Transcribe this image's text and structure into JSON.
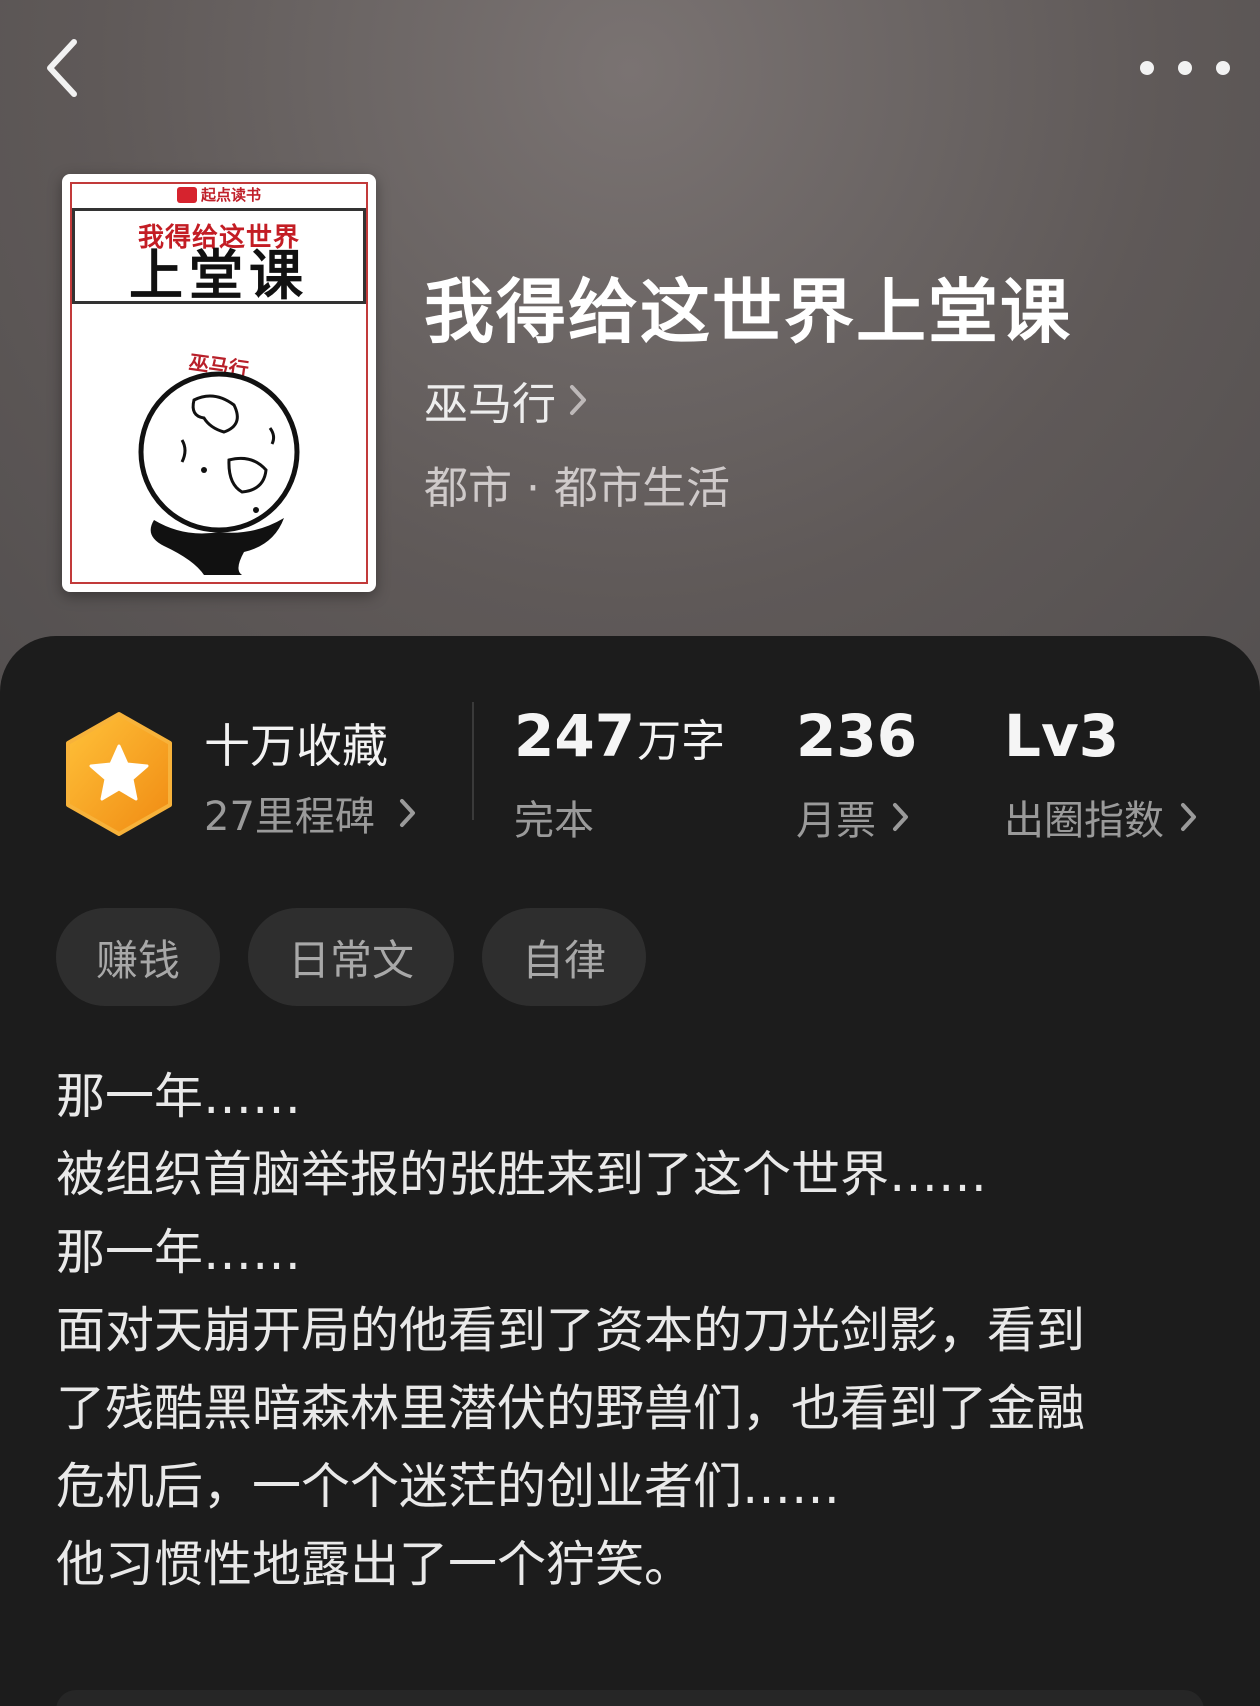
{
  "nav": {
    "back_icon": "chevron-left-icon",
    "more_icon": "more-horizontal-icon"
  },
  "cover": {
    "brand": "起点读书",
    "title_line1": "我得给这世界",
    "title_line2": "上堂课",
    "author": "巫马行"
  },
  "book": {
    "title": "我得给这世界上堂课",
    "author": "巫马行",
    "category": "都市 · 都市生活"
  },
  "stats": {
    "favorites": {
      "title": "十万收藏",
      "milestone": "27里程碑"
    },
    "words": {
      "value": "247",
      "unit": "万字",
      "label": "完本"
    },
    "monthly_tickets": {
      "value": "236",
      "label": "月票"
    },
    "breakout": {
      "value": "Lv3",
      "label": "出圈指数"
    }
  },
  "tags": [
    "赚钱",
    "日常文",
    "自律"
  ],
  "synopsis": [
    "那一年……",
    "被组织首脑举报的张胜来到了这个世界……",
    "那一年……",
    "面对天崩开局的他看到了资本的刀光剑影，看到",
    "了残酷黑暗森林里潜伏的野兽们，也看到了金融",
    "危机后，一个个迷茫的创业者们……",
    "他习惯性地露出了一个狞笑。"
  ],
  "colors": {
    "badge_orange": "#f5a31a",
    "panel_bg": "#1c1c1c",
    "tag_bg": "#2e2e2e"
  }
}
